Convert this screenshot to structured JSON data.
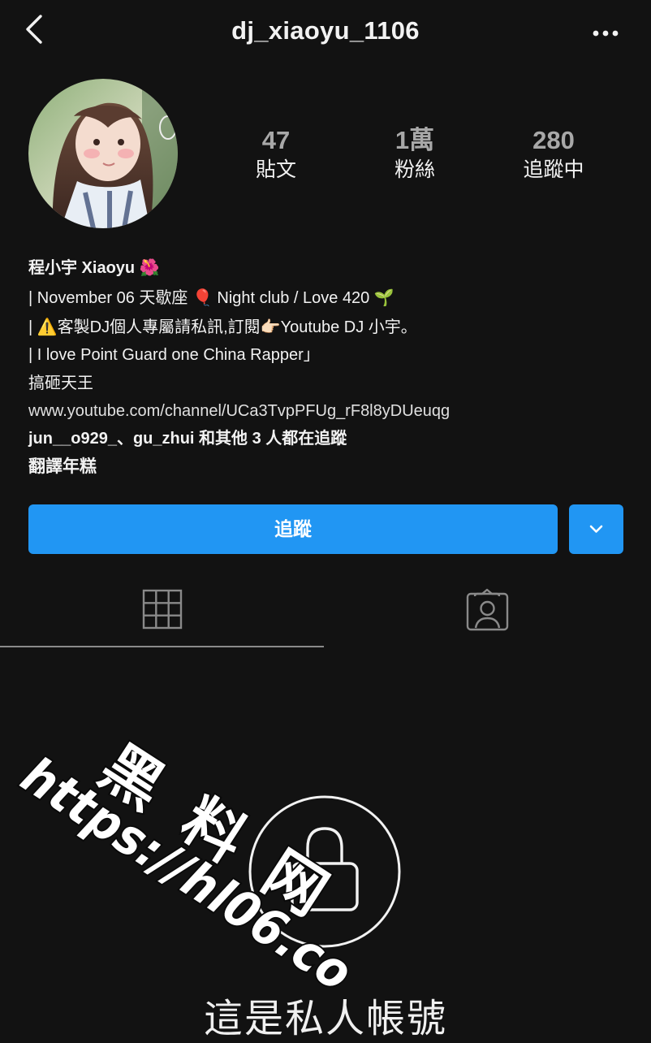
{
  "header": {
    "username": "dj_xiaoyu_1106"
  },
  "stats": {
    "posts": {
      "value": "47",
      "label": "貼文"
    },
    "followers": {
      "value": "1萬",
      "label": "粉絲"
    },
    "following": {
      "value": "280",
      "label": "追蹤中"
    }
  },
  "bio": {
    "name": "程小宇 Xiaoyu",
    "name_emoji": "🌺",
    "line1_a": "| November 06 天歇座",
    "line1_emoji1": "🎈",
    "line1_b": "Night club / Love 420",
    "line1_emoji2": "🌱",
    "line2_a": "|",
    "line2_emoji1": "⚠️",
    "line2_b": "客製DJ個人專屬請私訊,訂閱",
    "line2_emoji2": "👉🏻",
    "line2_c": "Youtube DJ 小宇。",
    "line3": "| I love Point Guard one China Rapper」",
    "line4": "搞砸天王",
    "link": "www.youtube.com/channel/UCa3TvpPFUg_rF8l8yDUeuqg",
    "followed_by": "jun__o929_、gu_zhui 和其他 3 人都在追蹤",
    "translate": "翻譯年糕"
  },
  "actions": {
    "follow_label": "追蹤"
  },
  "tabs": {
    "grid_icon": "grid-icon",
    "tagged_icon": "tagged-person-icon"
  },
  "private": {
    "icon": "lock-icon",
    "text": "這是私人帳號"
  },
  "watermark": {
    "line1": "黑 料 网",
    "line2": "https://hl06.co"
  },
  "colors": {
    "background": "#121212",
    "accent": "#2196f3",
    "text": "#f2f2f2",
    "muted": "#a8a8a8"
  }
}
